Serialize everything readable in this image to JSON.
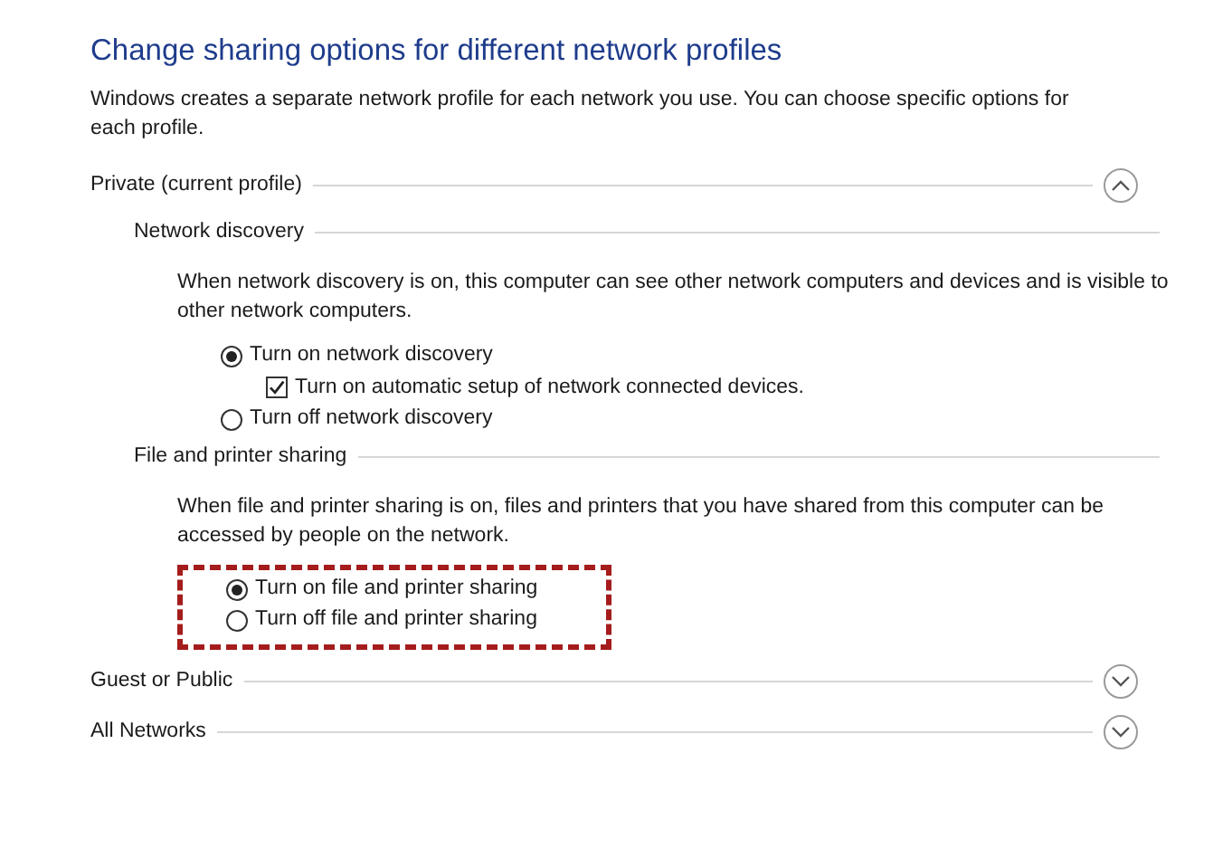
{
  "title": "Change sharing options for different network profiles",
  "description": "Windows creates a separate network profile for each network you use. You can choose specific options for each profile.",
  "profiles": [
    {
      "label": "Private (current profile)",
      "expanded": true,
      "sections": [
        {
          "heading": "Network discovery",
          "text": "When network discovery is on, this computer can see other network computers and devices and is visible to other network computers.",
          "highlighted": false,
          "options": [
            {
              "kind": "radio",
              "label": "Turn on network discovery",
              "selected": true,
              "children": [
                {
                  "kind": "checkbox",
                  "label": "Turn on automatic setup of network connected devices.",
                  "checked": true
                }
              ]
            },
            {
              "kind": "radio",
              "label": "Turn off network discovery",
              "selected": false
            }
          ]
        },
        {
          "heading": "File and printer sharing",
          "text": "When file and printer sharing is on, files and printers that you have shared from this computer can be accessed by people on the network.",
          "highlighted": true,
          "options": [
            {
              "kind": "radio",
              "label": "Turn on file and printer sharing",
              "selected": true
            },
            {
              "kind": "radio",
              "label": "Turn off file and printer sharing",
              "selected": false
            }
          ]
        }
      ]
    },
    {
      "label": "Guest or Public",
      "expanded": false
    },
    {
      "label": "All Networks",
      "expanded": false
    }
  ]
}
